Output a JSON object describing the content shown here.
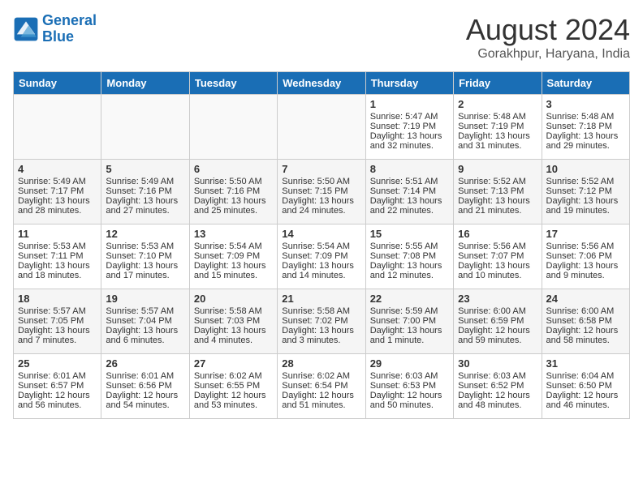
{
  "header": {
    "logo_line1": "General",
    "logo_line2": "Blue",
    "month": "August 2024",
    "location": "Gorakhpur, Haryana, India"
  },
  "weekdays": [
    "Sunday",
    "Monday",
    "Tuesday",
    "Wednesday",
    "Thursday",
    "Friday",
    "Saturday"
  ],
  "weeks": [
    [
      {
        "day": "",
        "info": ""
      },
      {
        "day": "",
        "info": ""
      },
      {
        "day": "",
        "info": ""
      },
      {
        "day": "",
        "info": ""
      },
      {
        "day": "1",
        "info": "Sunrise: 5:47 AM\nSunset: 7:19 PM\nDaylight: 13 hours\nand 32 minutes."
      },
      {
        "day": "2",
        "info": "Sunrise: 5:48 AM\nSunset: 7:19 PM\nDaylight: 13 hours\nand 31 minutes."
      },
      {
        "day": "3",
        "info": "Sunrise: 5:48 AM\nSunset: 7:18 PM\nDaylight: 13 hours\nand 29 minutes."
      }
    ],
    [
      {
        "day": "4",
        "info": "Sunrise: 5:49 AM\nSunset: 7:17 PM\nDaylight: 13 hours\nand 28 minutes."
      },
      {
        "day": "5",
        "info": "Sunrise: 5:49 AM\nSunset: 7:16 PM\nDaylight: 13 hours\nand 27 minutes."
      },
      {
        "day": "6",
        "info": "Sunrise: 5:50 AM\nSunset: 7:16 PM\nDaylight: 13 hours\nand 25 minutes."
      },
      {
        "day": "7",
        "info": "Sunrise: 5:50 AM\nSunset: 7:15 PM\nDaylight: 13 hours\nand 24 minutes."
      },
      {
        "day": "8",
        "info": "Sunrise: 5:51 AM\nSunset: 7:14 PM\nDaylight: 13 hours\nand 22 minutes."
      },
      {
        "day": "9",
        "info": "Sunrise: 5:52 AM\nSunset: 7:13 PM\nDaylight: 13 hours\nand 21 minutes."
      },
      {
        "day": "10",
        "info": "Sunrise: 5:52 AM\nSunset: 7:12 PM\nDaylight: 13 hours\nand 19 minutes."
      }
    ],
    [
      {
        "day": "11",
        "info": "Sunrise: 5:53 AM\nSunset: 7:11 PM\nDaylight: 13 hours\nand 18 minutes."
      },
      {
        "day": "12",
        "info": "Sunrise: 5:53 AM\nSunset: 7:10 PM\nDaylight: 13 hours\nand 17 minutes."
      },
      {
        "day": "13",
        "info": "Sunrise: 5:54 AM\nSunset: 7:09 PM\nDaylight: 13 hours\nand 15 minutes."
      },
      {
        "day": "14",
        "info": "Sunrise: 5:54 AM\nSunset: 7:09 PM\nDaylight: 13 hours\nand 14 minutes."
      },
      {
        "day": "15",
        "info": "Sunrise: 5:55 AM\nSunset: 7:08 PM\nDaylight: 13 hours\nand 12 minutes."
      },
      {
        "day": "16",
        "info": "Sunrise: 5:56 AM\nSunset: 7:07 PM\nDaylight: 13 hours\nand 10 minutes."
      },
      {
        "day": "17",
        "info": "Sunrise: 5:56 AM\nSunset: 7:06 PM\nDaylight: 13 hours\nand 9 minutes."
      }
    ],
    [
      {
        "day": "18",
        "info": "Sunrise: 5:57 AM\nSunset: 7:05 PM\nDaylight: 13 hours\nand 7 minutes."
      },
      {
        "day": "19",
        "info": "Sunrise: 5:57 AM\nSunset: 7:04 PM\nDaylight: 13 hours\nand 6 minutes."
      },
      {
        "day": "20",
        "info": "Sunrise: 5:58 AM\nSunset: 7:03 PM\nDaylight: 13 hours\nand 4 minutes."
      },
      {
        "day": "21",
        "info": "Sunrise: 5:58 AM\nSunset: 7:02 PM\nDaylight: 13 hours\nand 3 minutes."
      },
      {
        "day": "22",
        "info": "Sunrise: 5:59 AM\nSunset: 7:00 PM\nDaylight: 13 hours\nand 1 minute."
      },
      {
        "day": "23",
        "info": "Sunrise: 6:00 AM\nSunset: 6:59 PM\nDaylight: 12 hours\nand 59 minutes."
      },
      {
        "day": "24",
        "info": "Sunrise: 6:00 AM\nSunset: 6:58 PM\nDaylight: 12 hours\nand 58 minutes."
      }
    ],
    [
      {
        "day": "25",
        "info": "Sunrise: 6:01 AM\nSunset: 6:57 PM\nDaylight: 12 hours\nand 56 minutes."
      },
      {
        "day": "26",
        "info": "Sunrise: 6:01 AM\nSunset: 6:56 PM\nDaylight: 12 hours\nand 54 minutes."
      },
      {
        "day": "27",
        "info": "Sunrise: 6:02 AM\nSunset: 6:55 PM\nDaylight: 12 hours\nand 53 minutes."
      },
      {
        "day": "28",
        "info": "Sunrise: 6:02 AM\nSunset: 6:54 PM\nDaylight: 12 hours\nand 51 minutes."
      },
      {
        "day": "29",
        "info": "Sunrise: 6:03 AM\nSunset: 6:53 PM\nDaylight: 12 hours\nand 50 minutes."
      },
      {
        "day": "30",
        "info": "Sunrise: 6:03 AM\nSunset: 6:52 PM\nDaylight: 12 hours\nand 48 minutes."
      },
      {
        "day": "31",
        "info": "Sunrise: 6:04 AM\nSunset: 6:50 PM\nDaylight: 12 hours\nand 46 minutes."
      }
    ]
  ]
}
